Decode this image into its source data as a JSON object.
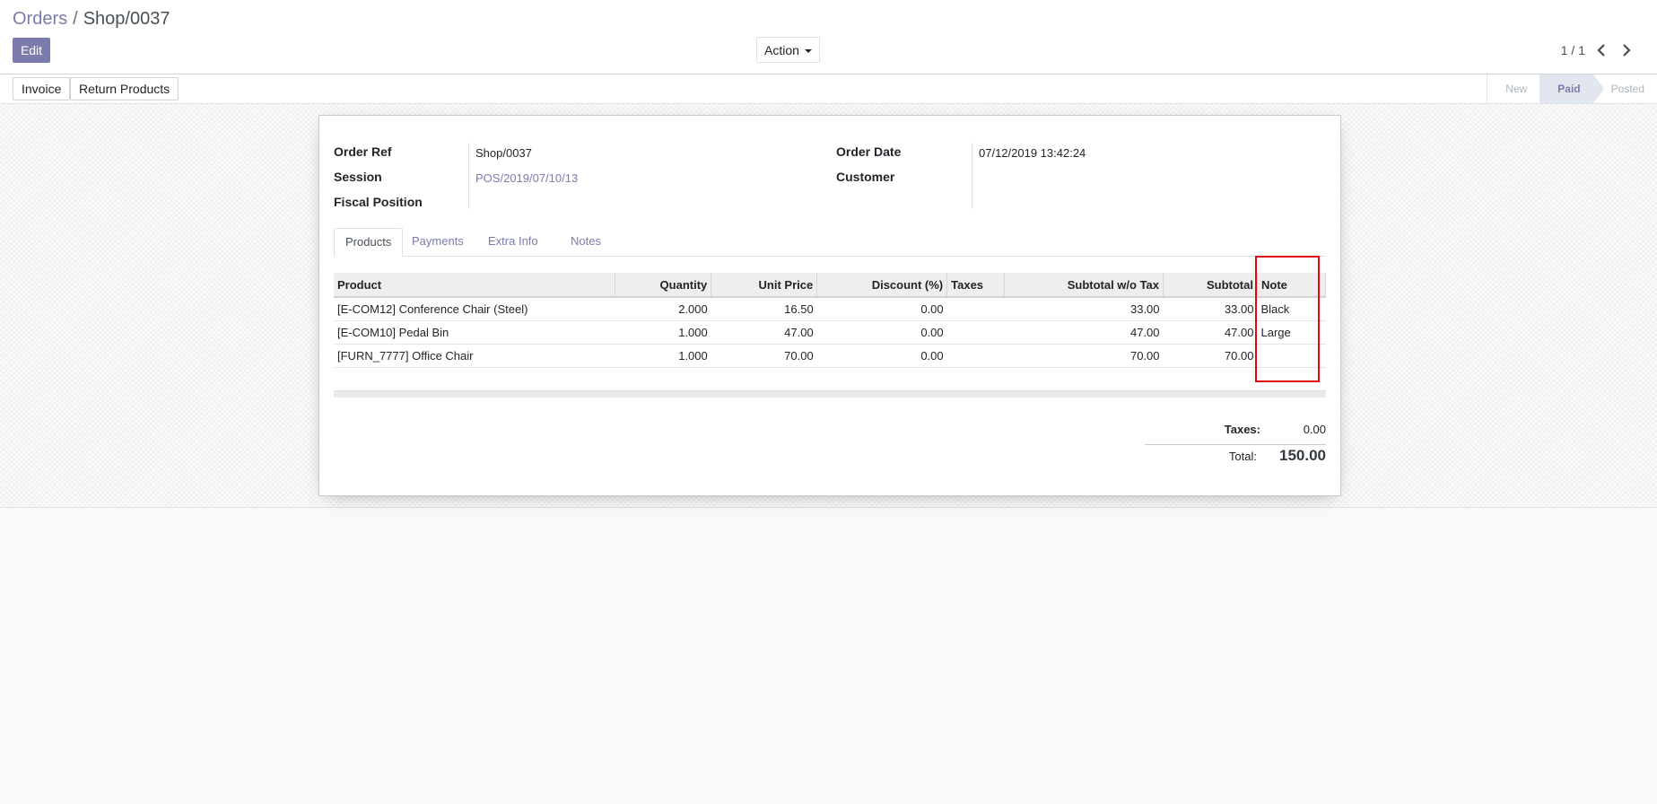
{
  "breadcrumb": {
    "parent": "Orders",
    "separator": "/",
    "current": "Shop/0037"
  },
  "toolbar": {
    "edit_label": "Edit",
    "action_label": "Action"
  },
  "pager": {
    "value": "1 / 1"
  },
  "statusbar": {
    "buttons": [
      "Invoice",
      "Return Products"
    ],
    "stages": [
      {
        "label": "New",
        "active": false
      },
      {
        "label": "Paid",
        "active": true
      },
      {
        "label": "Posted",
        "active": false
      }
    ]
  },
  "form": {
    "order_ref_label": "Order Ref",
    "order_ref": "Shop/0037",
    "session_label": "Session",
    "session": "POS/2019/07/10/13",
    "fiscal_position_label": "Fiscal Position",
    "fiscal_position": "",
    "order_date_label": "Order Date",
    "order_date": "07/12/2019 13:42:24",
    "customer_label": "Customer",
    "customer": ""
  },
  "tabs": [
    "Products",
    "Payments",
    "Extra Info",
    "Notes"
  ],
  "lines": {
    "headers": [
      "Product",
      "Quantity",
      "Unit Price",
      "Discount (%)",
      "Taxes",
      "Subtotal w/o Tax",
      "Subtotal",
      "Note"
    ],
    "rows": [
      [
        "[E-COM12] Conference Chair (Steel)",
        "2.000",
        "16.50",
        "0.00",
        "",
        "33.00",
        "33.00",
        "Black"
      ],
      [
        "[E-COM10] Pedal Bin",
        "1.000",
        "47.00",
        "0.00",
        "",
        "47.00",
        "47.00",
        "Large"
      ],
      [
        "[FURN_7777] Office Chair",
        "1.000",
        "70.00",
        "0.00",
        "",
        "70.00",
        "70.00",
        ""
      ]
    ]
  },
  "totals": {
    "taxes_label": "Taxes:",
    "taxes": "0.00",
    "total_label": "Total:",
    "total": "150.00"
  },
  "colors": {
    "accent": "#7c7bad",
    "highlight": "#e30613"
  }
}
